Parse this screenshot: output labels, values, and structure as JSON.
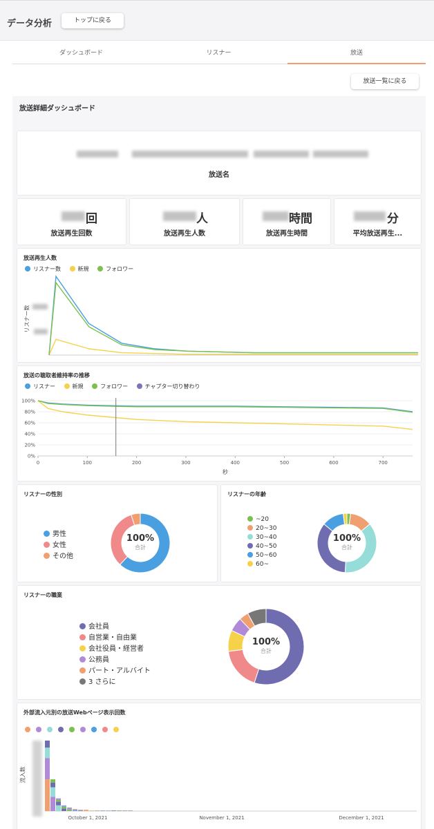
{
  "header": {
    "title": "データ分析",
    "top_button": "トップに戻る"
  },
  "tabs": [
    {
      "label": "ダッシュボード"
    },
    {
      "label": "リスナー"
    },
    {
      "label": "放送",
      "active": true
    }
  ],
  "back_to_list": "放送一覧に戻る",
  "dashboard_title": "放送詳細ダッシュボード",
  "broadcast": {
    "name_label": "放送名"
  },
  "kpis": [
    {
      "suffix": "回",
      "label": "放送再生回数"
    },
    {
      "suffix": "人",
      "label": "放送再生人数"
    },
    {
      "suffix": "時間",
      "label": "放送再生時間"
    },
    {
      "suffix": "分",
      "label": "平均放送再生..."
    }
  ],
  "plays_chart": {
    "title": "放送再生人数",
    "ylabel": "リスナー数",
    "legend": [
      {
        "name": "リスナー数",
        "color": "#4a9fe0"
      },
      {
        "name": "新規",
        "color": "#f5d24a"
      },
      {
        "name": "フォロワー",
        "color": "#7cc04e"
      }
    ]
  },
  "retention_chart": {
    "title": "放送の聴取者維持率の推移",
    "xlabel": "秒",
    "legend": [
      {
        "name": "リスナー",
        "color": "#4a9fe0"
      },
      {
        "name": "新規",
        "color": "#f5d24a"
      },
      {
        "name": "フォロワー",
        "color": "#7cc04e"
      },
      {
        "name": "チャプター切り替わり",
        "color": "#7a74b8"
      }
    ]
  },
  "gender": {
    "title": "リスナーの性別",
    "center_pct": "100%",
    "center_sub": "合計",
    "legend": [
      {
        "name": "男性",
        "color": "#4a9fe0"
      },
      {
        "name": "女性",
        "color": "#f08a8a"
      },
      {
        "name": "その他",
        "color": "#f0a070"
      }
    ]
  },
  "age": {
    "title": "リスナーの年齢",
    "center_pct": "100%",
    "center_sub": "合計",
    "legend": [
      {
        "name": "~20",
        "color": "#7cc04e"
      },
      {
        "name": "20~30",
        "color": "#f0a070"
      },
      {
        "name": "30~40",
        "color": "#96dcd8"
      },
      {
        "name": "40~50",
        "color": "#6f6cb0"
      },
      {
        "name": "50~60",
        "color": "#4a9fe0"
      },
      {
        "name": "60~",
        "color": "#f5d24a"
      }
    ]
  },
  "occupation": {
    "title": "リスナーの職業",
    "center_pct": "100%",
    "center_sub": "合計",
    "legend": [
      {
        "name": "会社員",
        "color": "#6f6cb0"
      },
      {
        "name": "自営業・自由業",
        "color": "#f08a8a"
      },
      {
        "name": "会社役員・経営者",
        "color": "#f5d24a"
      },
      {
        "name": "公務員",
        "color": "#b08ad8"
      },
      {
        "name": "パート・アルバイト",
        "color": "#f0a070"
      },
      {
        "name": "3 さらに",
        "color": "#777777"
      }
    ]
  },
  "external_chart": {
    "title": "外部流入元別の放送Webページ表示回数",
    "ylabel": "流入数",
    "legend_colors": [
      "#f0a070",
      "#b08ad8",
      "#96dcd8",
      "#6f6cb0",
      "#7cc04e",
      "#b08ad8",
      "#4a9fe0",
      "#f08a8a",
      "#f5d24a"
    ]
  },
  "chart_data": [
    {
      "type": "line",
      "title": "放送再生人数",
      "ylabel": "リスナー数",
      "series": [
        {
          "name": "リスナー数",
          "values": [
            0,
            100,
            40,
            15,
            8,
            5,
            4,
            3,
            3,
            3,
            3,
            3,
            3
          ]
        },
        {
          "name": "新規",
          "values": [
            0,
            20,
            8,
            3,
            2,
            1,
            1,
            1,
            1,
            1,
            1,
            1,
            1
          ]
        },
        {
          "name": "フォロワー",
          "values": [
            0,
            92,
            36,
            13,
            7,
            5,
            4,
            3,
            3,
            3,
            3,
            3,
            3
          ]
        }
      ]
    },
    {
      "type": "line",
      "title": "放送の聴取者維持率の推移",
      "xlabel": "秒",
      "x": [
        0,
        20,
        50,
        100,
        150,
        200,
        300,
        400,
        500,
        600,
        700,
        760
      ],
      "xticks": [
        0,
        100,
        200,
        300,
        400,
        500,
        600,
        700
      ],
      "yticks": [
        "0%",
        "20%",
        "40%",
        "60%",
        "80%",
        "100%"
      ],
      "xlim": [
        0,
        760
      ],
      "ylim": [
        0,
        100
      ],
      "chapter_x": 158,
      "series": [
        {
          "name": "リスナー",
          "values": [
            100,
            96,
            94,
            92,
            91,
            90,
            90,
            90,
            89,
            88,
            87,
            80
          ]
        },
        {
          "name": "新規",
          "values": [
            100,
            86,
            80,
            74,
            70,
            66,
            62,
            60,
            58,
            56,
            54,
            48
          ]
        },
        {
          "name": "フォロワー",
          "values": [
            100,
            95,
            93,
            91,
            90,
            89,
            89,
            89,
            88,
            87,
            86,
            79
          ]
        }
      ]
    },
    {
      "type": "pie",
      "title": "リスナーの性別",
      "labels": [
        "男性",
        "女性",
        "その他"
      ],
      "values": [
        62,
        33,
        5
      ]
    },
    {
      "type": "pie",
      "title": "リスナーの年齢",
      "labels": [
        "~20",
        "20~30",
        "30~40",
        "40~50",
        "50~60",
        "60~"
      ],
      "values": [
        2,
        12,
        37,
        35,
        12,
        2
      ]
    },
    {
      "type": "pie",
      "title": "リスナーの職業",
      "labels": [
        "会社員",
        "自営業・自由業",
        "会社役員・経営者",
        "公務員",
        "パート・アルバイト",
        "3 さらに"
      ],
      "values": [
        55,
        18,
        9,
        6,
        4,
        8
      ]
    },
    {
      "type": "bar",
      "title": "外部流入元別の放送Webページ表示回数",
      "ylabel": "流入数",
      "xticks": [
        "October 1, 2021",
        "November 1, 2021",
        "December 1, 2021"
      ],
      "values": [
        100,
        45,
        18,
        8,
        5,
        3,
        2,
        2,
        1,
        1,
        1,
        1,
        1,
        1,
        1,
        1
      ]
    }
  ]
}
